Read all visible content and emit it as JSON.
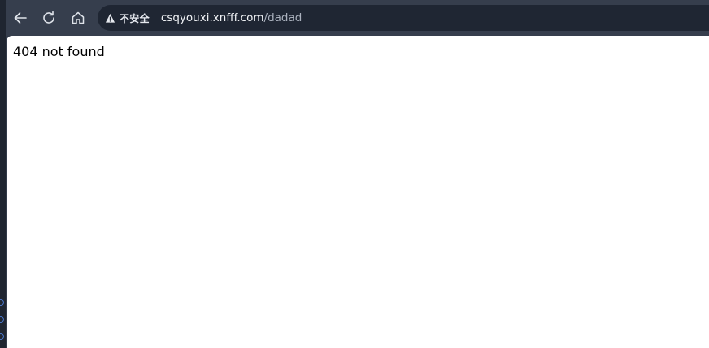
{
  "browser": {
    "security_label": "不安全",
    "url_host": "csqyouxi.xnfff.com",
    "url_path": "/dadad",
    "icons": {
      "back": "arrow-left-icon",
      "reload": "reload-icon",
      "home": "home-icon",
      "security": "warning-triangle-icon"
    },
    "colors": {
      "toolbar": "#363e4d",
      "omnibox": "#1f2633",
      "page_background": "#ffffff"
    }
  },
  "page": {
    "message": "404 not found"
  }
}
